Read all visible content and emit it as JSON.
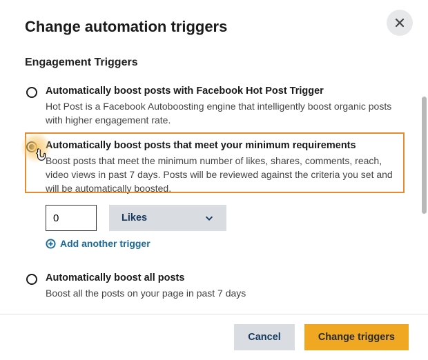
{
  "title": "Change automation triggers",
  "section_heading": "Engagement Triggers",
  "options": {
    "a": {
      "title": "Automatically boost posts with Facebook Hot Post Trigger",
      "desc": "Hot Post is a Facebook Autoboosting engine that intelligently boost organic posts with higher engagement rate."
    },
    "b": {
      "title": "Automatically boost posts that meet your minimum requirements",
      "desc": "Boost posts that meet the minimum number of likes, shares, comments, reach, video views in past 7 days. Posts will be reviewed against the criteria you set and will be automatically boosted."
    },
    "c": {
      "title": "Automatically boost all posts",
      "desc": "Boost all the posts on your page in past 7 days"
    }
  },
  "trigger": {
    "value": "0",
    "metric": "Likes",
    "add_label": "Add another trigger"
  },
  "footer": {
    "cancel": "Cancel",
    "confirm": "Change triggers"
  }
}
